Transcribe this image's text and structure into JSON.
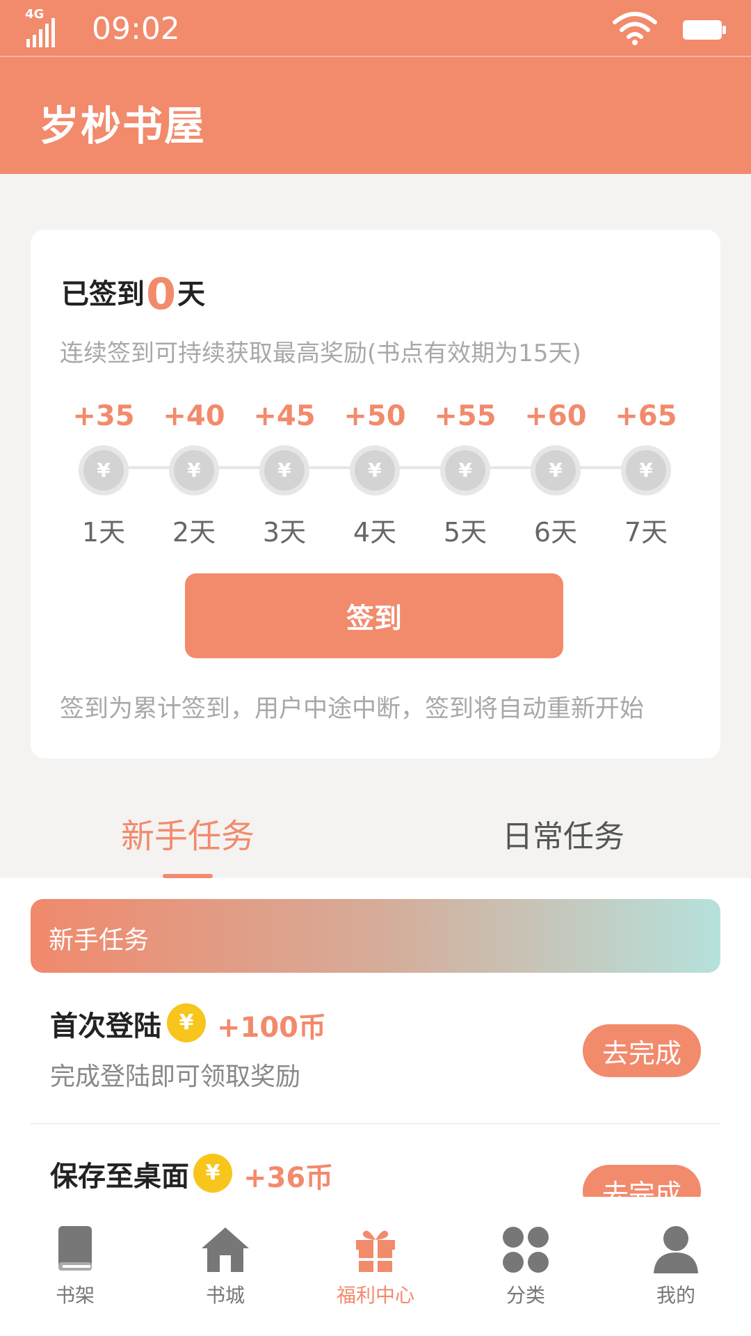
{
  "status_bar": {
    "network": "4G",
    "time": "09:02",
    "icons": [
      "signal-icon",
      "wifi-icon",
      "battery-icon"
    ]
  },
  "app_bar": {
    "title": "岁杪书屋"
  },
  "signin": {
    "title_prefix": "已签到",
    "days_count": "0",
    "title_suffix": "天",
    "subtitle": "连续签到可持续获取最高奖励(书点有效期为15天)",
    "days": [
      {
        "reward": "+35",
        "label": "1天"
      },
      {
        "reward": "+40",
        "label": "2天"
      },
      {
        "reward": "+45",
        "label": "3天"
      },
      {
        "reward": "+50",
        "label": "4天"
      },
      {
        "reward": "+55",
        "label": "5天"
      },
      {
        "reward": "+60",
        "label": "6天"
      },
      {
        "reward": "+65",
        "label": "7天"
      }
    ],
    "coin_symbol": "¥",
    "button_label": "签到",
    "note": "签到为累计签到，用户中途中断，签到将自动重新开始"
  },
  "tabs": [
    {
      "label": "新手任务",
      "active": true
    },
    {
      "label": "日常任务",
      "active": false
    }
  ],
  "task_section": {
    "banner_title": "新手任务",
    "tasks": [
      {
        "name": "首次登陆",
        "coin_symbol": "¥",
        "reward": "+100币",
        "desc": "完成登陆即可领取奖励",
        "button": "去完成"
      },
      {
        "name": "保存至桌面",
        "coin_symbol": "¥",
        "reward": "+36币",
        "desc": "",
        "button": "去完成"
      }
    ]
  },
  "bottom_nav": [
    {
      "label": "书架",
      "icon": "bookshelf-icon",
      "active": false
    },
    {
      "label": "书城",
      "icon": "home-icon",
      "active": false
    },
    {
      "label": "福利中心",
      "icon": "gift-icon",
      "active": true
    },
    {
      "label": "分类",
      "icon": "category-icon",
      "active": false
    },
    {
      "label": "我的",
      "icon": "user-icon",
      "active": false
    }
  ],
  "colors": {
    "primary": "#f28a6c",
    "coin_gold": "#f7c51c",
    "coin_gray": "#d3d3d3",
    "page_bg": "#f4f3f1"
  }
}
